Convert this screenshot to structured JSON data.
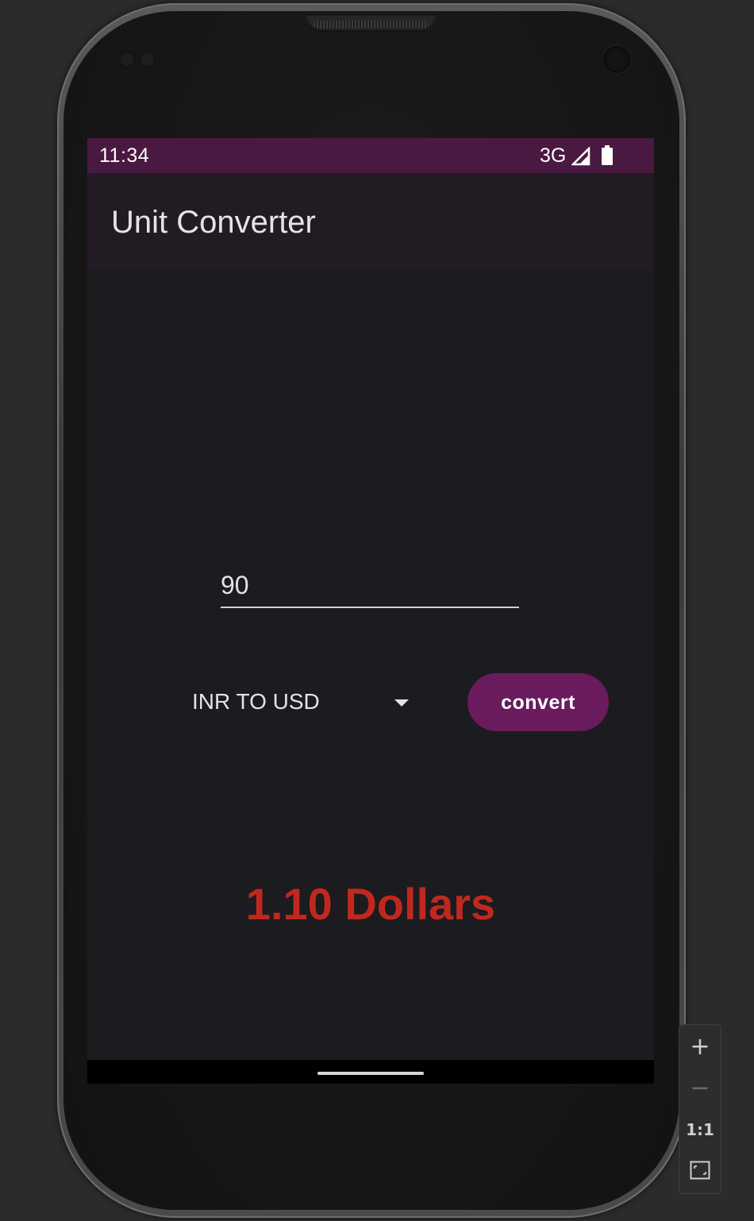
{
  "status_bar": {
    "time": "11:34",
    "network": "3G"
  },
  "app_bar": {
    "title": "Unit Converter"
  },
  "amount_input": {
    "value": "90"
  },
  "conversion_dropdown": {
    "selected": "INR TO USD"
  },
  "convert_button": {
    "label": "convert"
  },
  "result": {
    "text": "1.10 Dollars"
  },
  "emulator_controls": {
    "zoom_in": "+",
    "zoom_out": "−",
    "actual_size": "1:1"
  },
  "colors": {
    "status_bar": "#4a1942",
    "app_bar": "#231b24",
    "background": "#1c1b1f",
    "button": "#6a1b5e",
    "result_text": "#c0281f"
  },
  "icons": [
    "signal-icon",
    "battery-icon",
    "dropdown-arrow-icon",
    "fit-screen-icon"
  ]
}
